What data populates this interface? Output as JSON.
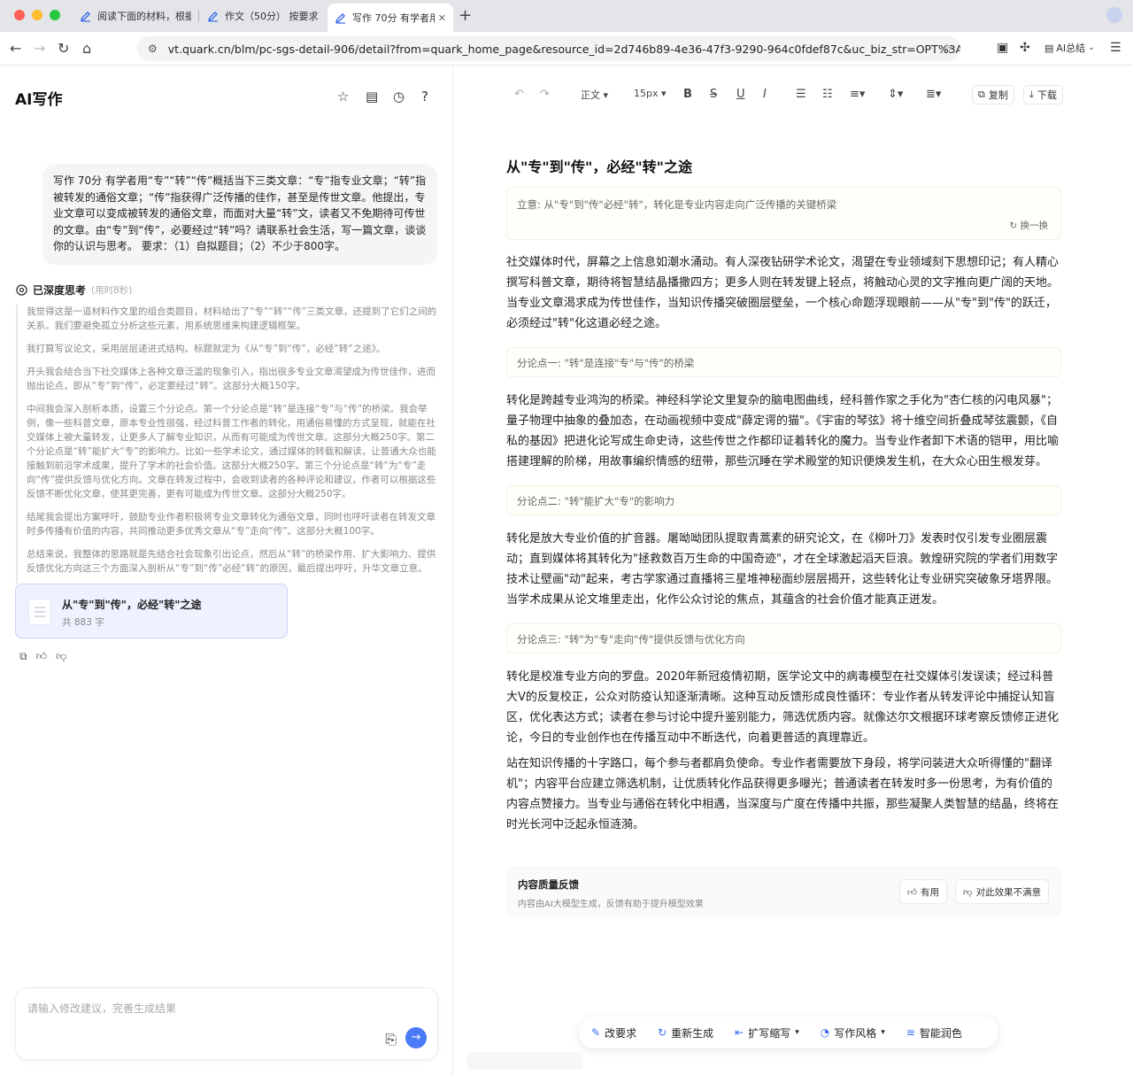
{
  "browser": {
    "tabs": [
      {
        "label": "阅读下面的材料，根据"
      },
      {
        "label": "作文（50分） 按要求作"
      },
      {
        "label": "写作 70分 有学者用"
      }
    ],
    "url": "vt.quark.cn/blm/pc-sgs-detail-906/detail?from=quark_home_page&resource_id=2d746b89-4e36-47f3-9290-964c0fdef87c&uc_biz_str=OPT%3AI...",
    "ai_summary_label": "AI总结",
    "colors": {
      "close": "#fe5f57",
      "minimize": "#febc2e",
      "maximize": "#28c840",
      "tab_icon": "#3b6cf0"
    }
  },
  "left": {
    "app_title": "AI写作",
    "prompt": "写作 70分 有学者用“专”“转”“传”概括当下三类文章：“专”指专业文章；“转”指被转发的通俗文章；“传”指获得广泛传播的佳作，甚至是传世文章。他提出，专业文章可以变成被转发的通俗文章，而面对大量“转”文，读者又不免期待可传世的文章。由“专”到“传”，必要经过“转”吗？请联系社会生活，写一篇文章，谈谈你的认识与思考。 要求：（1）自拟题目；（2）不少于800字。",
    "deep_thinking": {
      "title": "已深度思考",
      "time": "(用时8秒)",
      "paragraphs": [
        "我觉得这是一道材料作文里的组合类题目，材料给出了“专”“转”“传”三类文章，还提到了它们之间的关系。我们要避免孤立分析这些元素，用系统思维来构建逻辑框架。",
        "我打算写议论文，采用层层递进式结构。标题就定为《从“专”到“传”，必经“转”之途》。",
        "开头我会结合当下社交媒体上各种文章泛滥的现象引入，指出很多专业文章渴望成为传世佳作，进而抛出论点，即从“专”到“传”，必定要经过“转”。这部分大概150字。",
        "中间我会深入剖析本质，设置三个分论点。第一个分论点是“转”是连接“专”与“传”的桥梁。我会举例，像一些科普文章，原本专业性很强，经过科普工作者的转化，用通俗易懂的方式呈现，就能在社交媒体上被大量转发，让更多人了解专业知识，从而有可能成为传世文章。这部分大概250字。第二个分论点是“转”能扩大“专”的影响力。比如一些学术论文，通过媒体的转载和解读，让普通大众也能接触到前沿学术成果，提升了学术的社会价值。这部分大概250字。第三个分论点是“转”为“专”走向“传”提供反馈与优化方向。文章在转发过程中，会收到读者的各种评论和建议，作者可以根据这些反馈不断优化文章，使其更完善，更有可能成为传世文章。这部分大概250字。",
        "结尾我会提出方案呼吁，鼓励专业作者积极将专业文章转化为通俗文章，同时也呼吁读者在转发文章时多传播有价值的内容，共同推动更多优秀文章从“专”走向“传”。这部分大概100字。",
        "总结来说，我整体的思路就是先结合社会现象引出论点，然后从“转”的桥梁作用、扩大影响力、提供反馈优化方向这三个方面深入剖析从“专”到“传”必经“转”的原因，最后提出呼吁，升华文章立意。"
      ]
    },
    "doc_card": {
      "title": "从\"专\"到\"传\"，必经\"转\"之途",
      "count": "共 883 字"
    },
    "input_placeholder": "请输入修改建议，完善生成结果",
    "accent_color": "#4a7bf7"
  },
  "editor": {
    "toolbar": {
      "style": "正文",
      "size": "15px",
      "copy": "复制",
      "download": "下载"
    },
    "title": "从\"专\"到\"传\"，必经\"转\"之途",
    "idea": "立意: 从\"专\"到\"传\"必经\"转\"，转化是专业内容走向广泛传播的关键桥梁",
    "swap_label": "换一换",
    "intro": "社交媒体时代，屏幕之上信息如潮水涌动。有人深夜钻研学术论文，渴望在专业领域刻下思想印记；有人精心撰写科普文章，期待将智慧结晶播撒四方；更多人则在转发键上轻点，将触动心灵的文字推向更广阔的天地。当专业文章渴求成为传世佳作，当知识传播突破圈层壁垒，一个核心命题浮现眼前——从\"专\"到\"传\"的跃迁，必须经过\"转\"化这道必经之途。",
    "point1": "分论点一: \"转\"是连接\"专\"与\"传\"的桥梁",
    "body1": "转化是跨越专业鸿沟的桥梁。神经科学论文里复杂的脑电图曲线，经科普作家之手化为\"杏仁核的闪电风暴\"；量子物理中抽象的叠加态，在动画视频中变成\"薛定谔的猫\"。《宇宙的琴弦》将十维空间折叠成琴弦震颤，《自私的基因》把进化论写成生命史诗，这些传世之作都印证着转化的魔力。当专业作者卸下术语的铠甲，用比喻搭建理解的阶梯，用故事编织情感的纽带，那些沉睡在学术殿堂的知识便焕发生机，在大众心田生根发芽。",
    "point2": "分论点二: \"转\"能扩大\"专\"的影响力",
    "body2": "转化是放大专业价值的扩音器。屠呦呦团队提取青蒿素的研究论文，在《柳叶刀》发表时仅引发专业圈层震动；直到媒体将其转化为\"拯救数百万生命的中国奇迹\"，才在全球激起滔天巨浪。敦煌研究院的学者们用数字技术让壁画\"动\"起来，考古学家通过直播将三星堆神秘面纱层层揭开，这些转化让专业研究突破象牙塔界限。当学术成果从论文堆里走出，化作公众讨论的焦点，其蕴含的社会价值才能真正迸发。",
    "point3": "分论点三: \"转\"为\"专\"走向\"传\"提供反馈与优化方向",
    "body3": "转化是校准专业方向的罗盘。2020年新冠疫情初期，医学论文中的病毒模型在社交媒体引发误读；经过科普大V的反复校正，公众对防疫认知逐渐清晰。这种互动反馈形成良性循环：专业作者从转发评论中捕捉认知盲区，优化表达方式；读者在参与讨论中提升鉴别能力，筛选优质内容。就像达尔文根据环球考察反馈修正进化论，今日的专业创作也在传播互动中不断迭代，向着更普适的真理靠近。",
    "conclusion": "站在知识传播的十字路口，每个参与者都肩负使命。专业作者需要放下身段，将学问装进大众听得懂的\"翻译机\"；内容平台应建立筛选机制，让优质转化作品获得更多曝光；普通读者在转发时多一份思考，为有价值的内容点赞接力。当专业与通俗在转化中相遇，当深度与广度在传播中共振，那些凝聚人类智慧的结晶，终将在时光长河中泛起永恒涟漪。",
    "feedback": {
      "title": "内容质量反馈",
      "subtitle": "内容由AI大模型生成，反馈有助于提升模型效果",
      "useful": "有用",
      "unsatisfied": "对此效果不满意"
    },
    "actions": [
      "改要求",
      "重新生成",
      "扩写缩写",
      "写作风格",
      "智能润色"
    ]
  }
}
